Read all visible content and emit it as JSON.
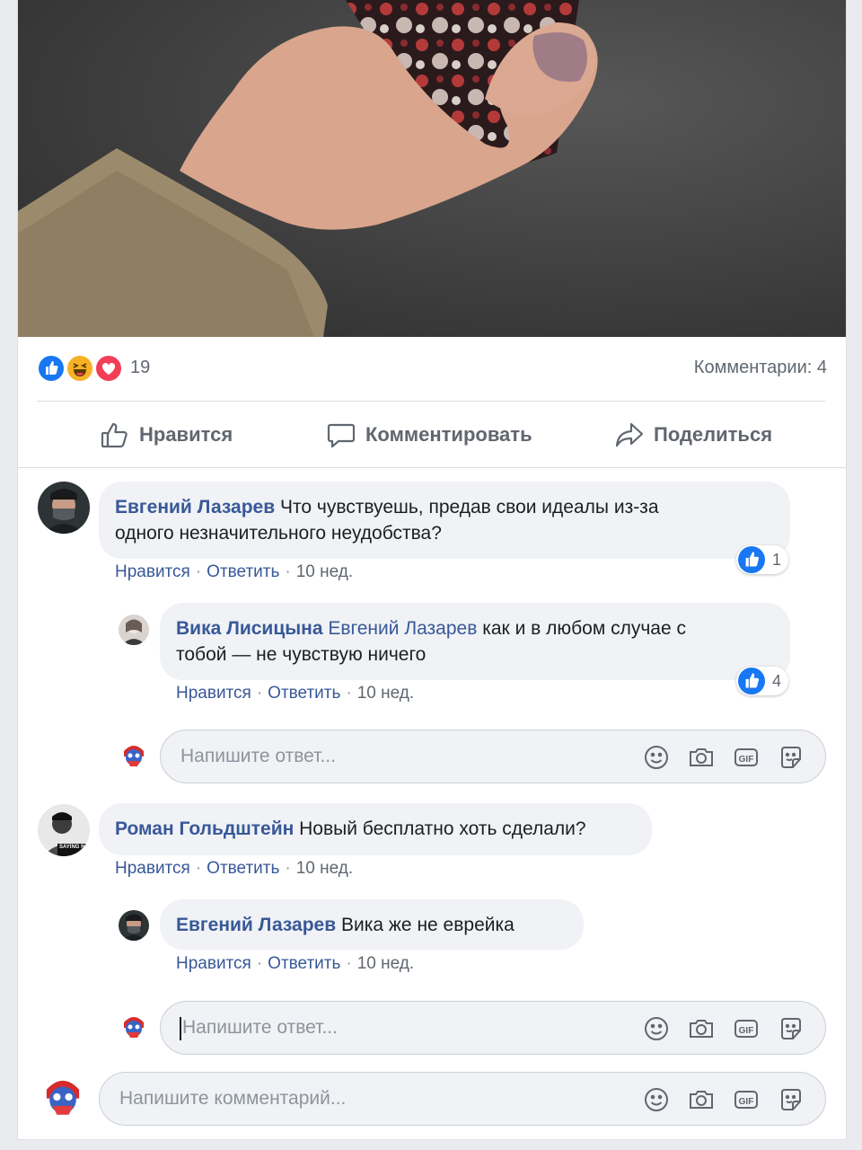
{
  "post": {
    "reaction_count": "19",
    "comments_count": "Комментарии: 4",
    "reaction_icons": [
      "like-icon",
      "haha-icon",
      "love-icon"
    ],
    "actions": {
      "like": "Нравится",
      "comment": "Комментировать",
      "share": "Поделиться"
    }
  },
  "comments": [
    {
      "author": "Евгений Лазарев",
      "text_line1": "Что чувствуешь, предав свои идеалы из-за",
      "text_line2": "одного незначительного неудобства?",
      "like": "Нравится",
      "reply": "Ответить",
      "time": "10 нед.",
      "likes": "1",
      "replies": [
        {
          "author": "Вика Лисицына",
          "mention": "Евгений Лазарев",
          "text_line1": "как и в любом случае с",
          "text_line2": "тобой — не чувствую ничего",
          "like": "Нравится",
          "reply": "Ответить",
          "time": "10 нед.",
          "likes": "4"
        }
      ],
      "reply_placeholder": "Напишите ответ..."
    },
    {
      "author": "Роман Гольдштейн",
      "text": "Новый бесплатно хоть сделали?",
      "like": "Нравится",
      "reply": "Ответить",
      "time": "10 нед.",
      "avatar_text": "SAYING NA",
      "replies": [
        {
          "author": "Евгений Лазарев",
          "text": "Вика же не еврейка",
          "like": "Нравится",
          "reply": "Ответить",
          "time": "10 нед."
        }
      ],
      "reply_placeholder": "Напишите ответ..."
    }
  ],
  "comment_input": {
    "placeholder": "Напишите комментарий..."
  },
  "colors": {
    "link": "#385898",
    "like_blue": "#1877f2",
    "love_red": "#f33e58",
    "haha_yellow": "#f7b125",
    "bubble_bg": "#f0f2f5"
  }
}
